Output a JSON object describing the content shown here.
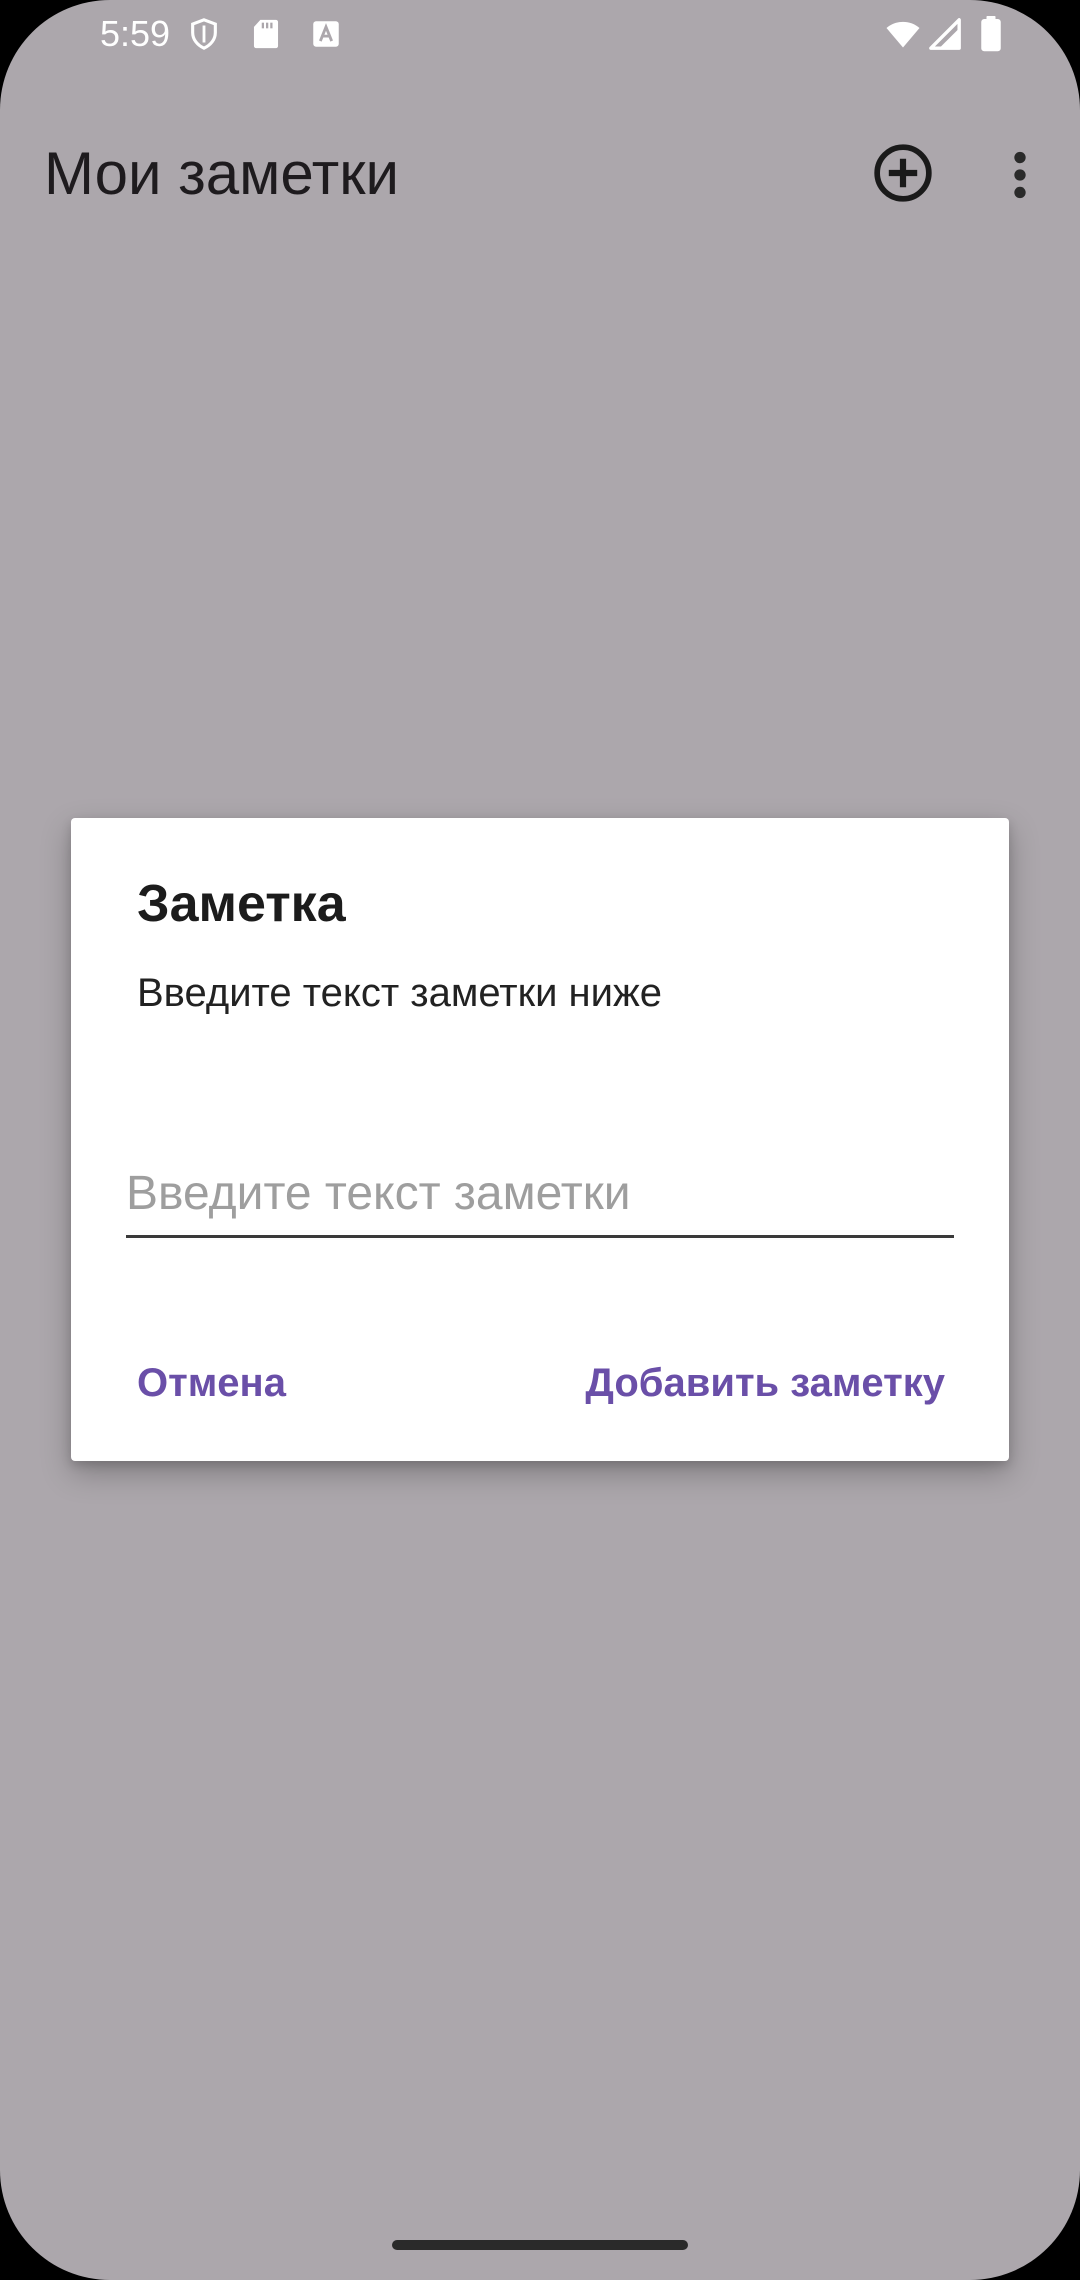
{
  "status_bar": {
    "time": "5:59",
    "left_icons": [
      "shield-icon",
      "sd-card-icon",
      "font-icon"
    ],
    "right_icons": [
      "wifi-icon",
      "cell-signal-icon",
      "battery-icon"
    ]
  },
  "app_bar": {
    "title": "Мои заметки",
    "actions": [
      "add-circle-icon",
      "more-vert-icon"
    ]
  },
  "dialog": {
    "title": "Заметка",
    "message": "Введите текст заметки ниже",
    "input": {
      "value": "",
      "placeholder": "Введите текст заметки"
    },
    "cancel_label": "Отмена",
    "confirm_label": "Добавить заметку"
  },
  "colors": {
    "scrim_background": "#aca7ac",
    "dialog_background": "#ffffff",
    "accent": "#6a4fa8"
  }
}
